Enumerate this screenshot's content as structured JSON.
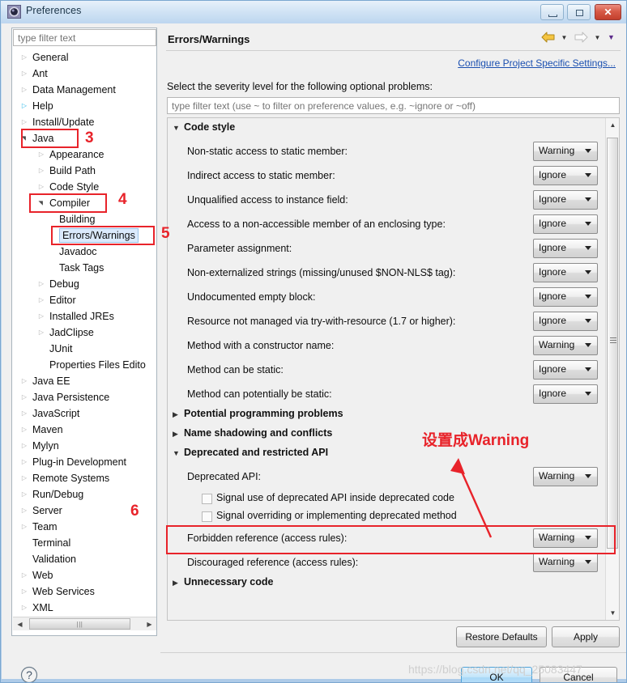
{
  "window": {
    "title": "Preferences",
    "icon": "preferences-gear-icon",
    "controls": {
      "minimize": "Minimize",
      "maximize": "Maximize",
      "close": "Close"
    }
  },
  "sidebar": {
    "filter_placeholder": "type filter text",
    "filter_value": "",
    "items": [
      {
        "label": "General",
        "level": 0,
        "twisty": "collapsed"
      },
      {
        "label": "Ant",
        "level": 0,
        "twisty": "collapsed"
      },
      {
        "label": "Data Management",
        "level": 0,
        "twisty": "collapsed"
      },
      {
        "label": "Help",
        "level": 0,
        "twisty": "collapsed-blue"
      },
      {
        "label": "Install/Update",
        "level": 0,
        "twisty": "collapsed"
      },
      {
        "label": "Java",
        "level": 0,
        "twisty": "expanded"
      },
      {
        "label": "Appearance",
        "level": 1,
        "twisty": "collapsed"
      },
      {
        "label": "Build Path",
        "level": 1,
        "twisty": "collapsed"
      },
      {
        "label": "Code Style",
        "level": 1,
        "twisty": "collapsed"
      },
      {
        "label": "Compiler",
        "level": 1,
        "twisty": "expanded"
      },
      {
        "label": "Building",
        "level": 2,
        "twisty": "none"
      },
      {
        "label": "Errors/Warnings",
        "level": 2,
        "twisty": "none",
        "selected": true
      },
      {
        "label": "Javadoc",
        "level": 2,
        "twisty": "none"
      },
      {
        "label": "Task Tags",
        "level": 2,
        "twisty": "none"
      },
      {
        "label": "Debug",
        "level": 1,
        "twisty": "collapsed"
      },
      {
        "label": "Editor",
        "level": 1,
        "twisty": "collapsed"
      },
      {
        "label": "Installed JREs",
        "level": 1,
        "twisty": "collapsed"
      },
      {
        "label": "JadClipse",
        "level": 1,
        "twisty": "collapsed"
      },
      {
        "label": "JUnit",
        "level": 1,
        "twisty": "none"
      },
      {
        "label": "Properties Files Edito",
        "level": 1,
        "twisty": "none"
      },
      {
        "label": "Java EE",
        "level": 0,
        "twisty": "collapsed"
      },
      {
        "label": "Java Persistence",
        "level": 0,
        "twisty": "collapsed"
      },
      {
        "label": "JavaScript",
        "level": 0,
        "twisty": "collapsed"
      },
      {
        "label": "Maven",
        "level": 0,
        "twisty": "collapsed"
      },
      {
        "label": "Mylyn",
        "level": 0,
        "twisty": "collapsed"
      },
      {
        "label": "Plug-in Development",
        "level": 0,
        "twisty": "collapsed"
      },
      {
        "label": "Remote Systems",
        "level": 0,
        "twisty": "collapsed"
      },
      {
        "label": "Run/Debug",
        "level": 0,
        "twisty": "collapsed"
      },
      {
        "label": "Server",
        "level": 0,
        "twisty": "collapsed"
      },
      {
        "label": "Team",
        "level": 0,
        "twisty": "collapsed"
      },
      {
        "label": "Terminal",
        "level": 0,
        "twisty": "none"
      },
      {
        "label": "Validation",
        "level": 0,
        "twisty": "none"
      },
      {
        "label": "Web",
        "level": 0,
        "twisty": "collapsed"
      },
      {
        "label": "Web Services",
        "level": 0,
        "twisty": "collapsed"
      },
      {
        "label": "XML",
        "level": 0,
        "twisty": "collapsed"
      }
    ]
  },
  "main": {
    "title": "Errors/Warnings",
    "nav": {
      "back_icon": "back-arrow-icon",
      "back_menu_icon": "chevron-down-icon",
      "forward_icon": "forward-arrow-icon",
      "forward_menu_icon": "chevron-down-icon",
      "view_menu_icon": "chevron-down-icon"
    },
    "configure_link": "Configure Project Specific Settings...",
    "severity_description": "Select the severity level for the following optional problems:",
    "pref_filter_placeholder": "type filter text (use ~ to filter on preference values, e.g. ~ignore or ~off)",
    "pref_filter_value": "",
    "sections": [
      {
        "name": "Code style",
        "expanded": true,
        "options": [
          {
            "label": "Non-static access to static member:",
            "value": "Warning"
          },
          {
            "label": "Indirect access to static member:",
            "value": "Ignore"
          },
          {
            "label": "Unqualified access to instance field:",
            "value": "Ignore"
          },
          {
            "label": "Access to a non-accessible member of an enclosing type:",
            "value": "Ignore"
          },
          {
            "label": "Parameter assignment:",
            "value": "Ignore"
          },
          {
            "label": "Non-externalized strings (missing/unused $NON-NLS$ tag):",
            "value": "Ignore"
          },
          {
            "label": "Undocumented empty block:",
            "value": "Ignore"
          },
          {
            "label": "Resource not managed via try-with-resource (1.7 or higher):",
            "value": "Ignore"
          },
          {
            "label": "Method with a constructor name:",
            "value": "Warning"
          },
          {
            "label": "Method can be static:",
            "value": "Ignore"
          },
          {
            "label": "Method can potentially be static:",
            "value": "Ignore"
          }
        ]
      },
      {
        "name": "Potential programming problems",
        "expanded": false,
        "options": []
      },
      {
        "name": "Name shadowing and conflicts",
        "expanded": false,
        "options": []
      },
      {
        "name": "Deprecated and restricted API",
        "expanded": true,
        "options": [
          {
            "label": "Deprecated API:",
            "value": "Warning"
          },
          {
            "label": "Forbidden reference (access rules):",
            "value": "Warning",
            "highlighted": true
          },
          {
            "label": "Discouraged reference (access rules):",
            "value": "Warning"
          }
        ],
        "checkboxes": [
          {
            "label": "Signal use of deprecated API inside deprecated code",
            "checked": false
          },
          {
            "label": "Signal overriding or implementing deprecated method",
            "checked": false
          }
        ]
      },
      {
        "name": "Unnecessary code",
        "expanded": false,
        "options": []
      }
    ],
    "buttons": {
      "restore_defaults": "Restore Defaults",
      "apply": "Apply"
    }
  },
  "footer": {
    "help_icon": "help-question-icon",
    "ok": "OK",
    "cancel": "Cancel"
  },
  "annotations": {
    "chinese_note": "设置成Warning",
    "numbers": [
      {
        "text": "3",
        "target": "java-tree-node"
      },
      {
        "text": "4",
        "target": "compiler-tree-node"
      },
      {
        "text": "5",
        "target": "errors-warnings-tree-node"
      },
      {
        "text": "6",
        "target": "forbidden-reference-row"
      }
    ]
  },
  "watermark": "https://blog.csdn.net/qq_25083447",
  "colors": {
    "annotation_red": "#e8232a",
    "link_blue": "#1a4fb0",
    "selection_blue": "#dbeafc",
    "title_gradient_start": "#e8f1fa",
    "dialog_bg": "#f0f0f0"
  }
}
